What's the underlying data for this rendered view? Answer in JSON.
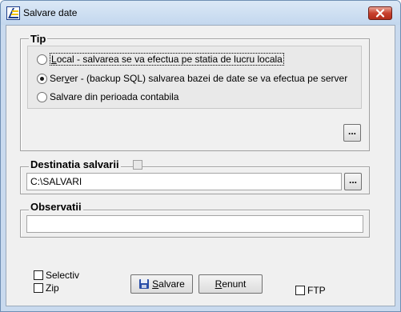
{
  "window": {
    "title": "Salvare date"
  },
  "tip": {
    "label": "Tip",
    "options": [
      {
        "label_first": "L",
        "label_rest": "ocal - salvarea se va efectua pe statia de lucru locala",
        "checked": false
      },
      {
        "label_first": "Ser",
        "label_u": "v",
        "label_rest": "er - (backup SQL) salvarea bazei de date se va efectua pe server",
        "checked": true
      },
      {
        "label": "Salvare  din perioada contabila",
        "checked": false
      }
    ],
    "browse_label": "..."
  },
  "destinatie": {
    "label": "Destinatia salvarii",
    "value": "C:\\SALVARI",
    "browse_label": "..."
  },
  "observatii": {
    "label": "Observatii",
    "value": ""
  },
  "options": {
    "selectiv": {
      "label": "Selectiv",
      "checked": false
    },
    "zip": {
      "label": "Zip",
      "checked": false
    },
    "ftp": {
      "label": "FTP",
      "checked": false
    }
  },
  "buttons": {
    "save": {
      "label_u": "S",
      "label_rest": "alvare"
    },
    "cancel": {
      "label_u": "R",
      "label_rest": "enunt"
    }
  },
  "colors": {
    "close": "#c9412e",
    "frame": "#c9daee"
  }
}
